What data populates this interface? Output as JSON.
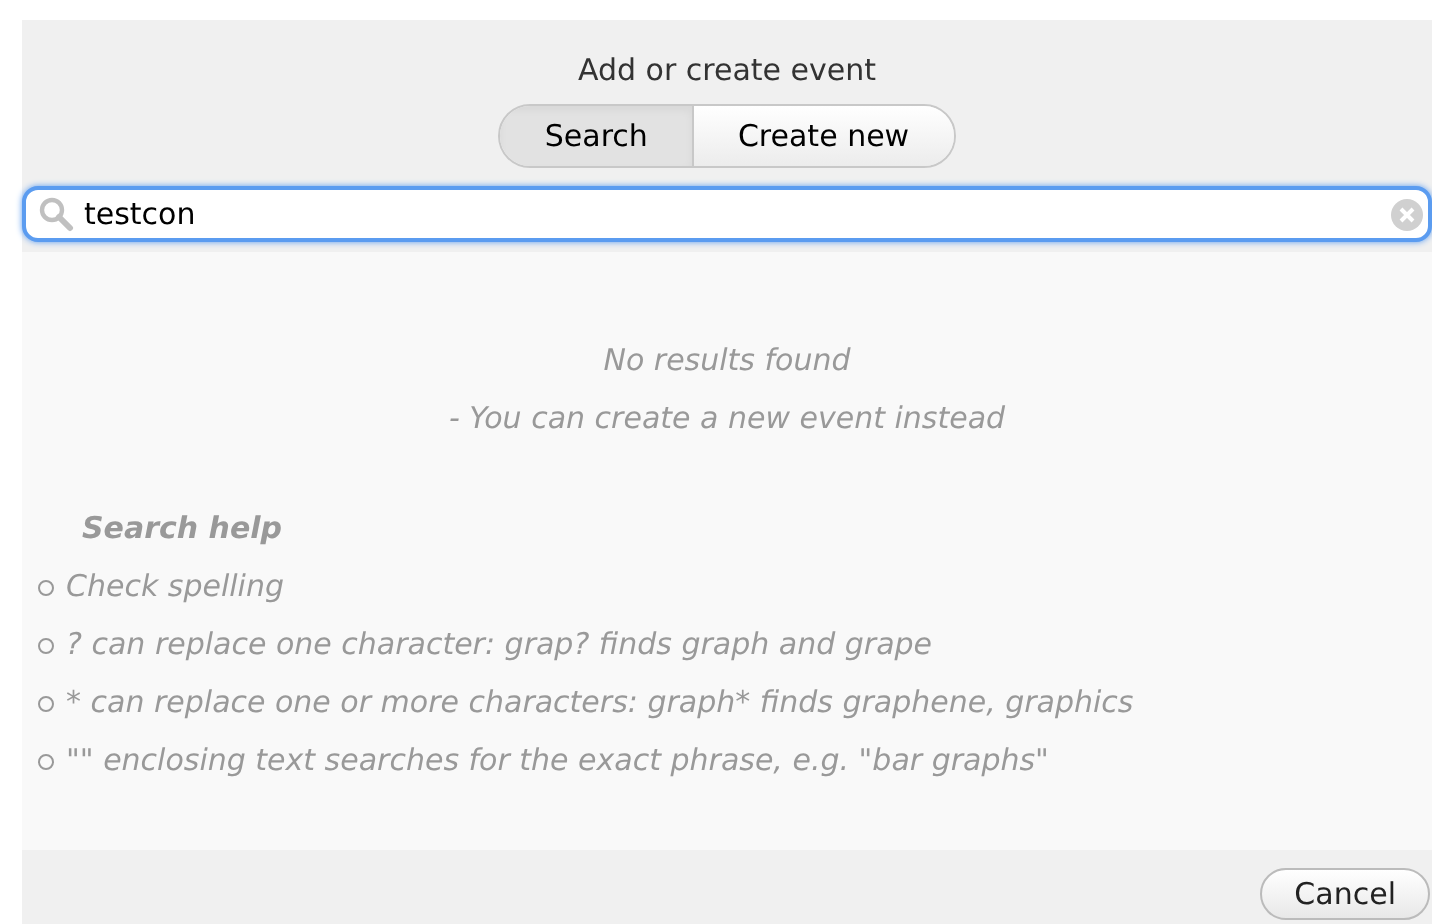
{
  "dialog": {
    "title": "Add or create event"
  },
  "tabs": [
    {
      "label": "Search",
      "selected": true
    },
    {
      "label": "Create new",
      "selected": false
    }
  ],
  "search": {
    "value": "testcon"
  },
  "results": {
    "message": "No results found",
    "hint": "- You can create a new event instead"
  },
  "help": {
    "title": "Search help",
    "items": [
      "Check spelling",
      "? can replace one character: grap? finds graph and grape",
      "* can replace one or more characters: graph* finds graphene, graphics",
      "\"\" enclosing text searches for the exact phrase, e.g. \"bar graphs\""
    ]
  },
  "buttons": [
    "Cancel"
  ]
}
